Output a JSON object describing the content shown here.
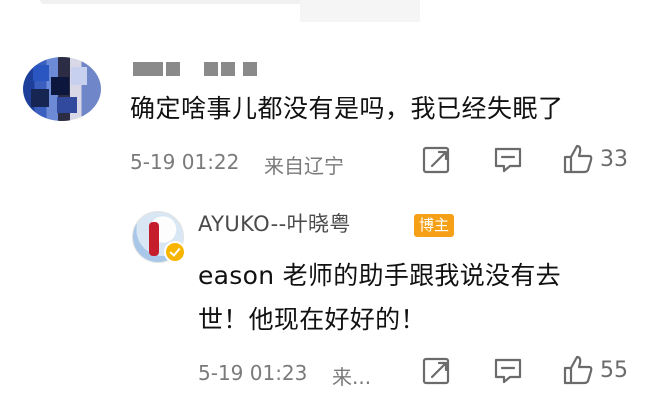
{
  "comment": {
    "username_masked": "█ ██ ██ ██",
    "text": "确定啥事儿都没有是吗，我已经失眠了",
    "date": "5-19 01:22",
    "location": "来自辽宁",
    "like_count": "33",
    "icons": [
      "share-icon",
      "comment-icon",
      "like-icon"
    ]
  },
  "reply": {
    "username": "AYUKO--叶晓粤",
    "badge": "博主",
    "text_line1": "eason 老师的助手跟我说没有去",
    "text_line2": "世！他现在好好的！",
    "date": "5-19 01:23",
    "location_truncated": "来...",
    "like_count": "55",
    "icons": [
      "share-icon",
      "comment-icon",
      "like-icon"
    ]
  },
  "colors": {
    "badge_bg": "#f6a017",
    "verified_badge": "#f7b500",
    "meta_text": "#7a7a7a",
    "icon": "#6b6b6b"
  }
}
